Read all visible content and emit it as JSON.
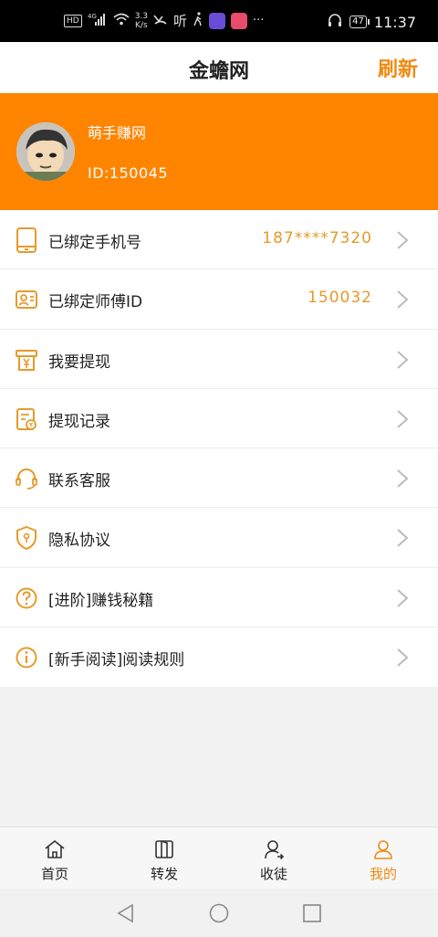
{
  "status_bar": {
    "hd": "HD",
    "network": "4G",
    "speed_top": "3.3",
    "speed_bottom": "K/s",
    "listen": "听",
    "dots": "···",
    "battery": "47",
    "time": "11:37"
  },
  "header": {
    "title": "金蟾网",
    "refresh_label": "刷新"
  },
  "profile": {
    "username": "萌手赚网",
    "user_id": "ID:150045"
  },
  "menu": {
    "items": [
      {
        "label": "已绑定手机号",
        "value": "187****7320",
        "icon": "phone-icon"
      },
      {
        "label": "已绑定师傅ID",
        "value": "150032",
        "icon": "id-card-icon"
      },
      {
        "label": "我要提现",
        "value": "",
        "icon": "withdraw-icon"
      },
      {
        "label": "提现记录",
        "value": "",
        "icon": "record-icon"
      },
      {
        "label": "联系客服",
        "value": "",
        "icon": "headset-icon"
      },
      {
        "label": "隐私协议",
        "value": "",
        "icon": "shield-icon"
      },
      {
        "label": "[进阶]赚钱秘籍",
        "value": "",
        "icon": "question-icon"
      },
      {
        "label": "[新手阅读]阅读规则",
        "value": "",
        "icon": "info-icon"
      }
    ]
  },
  "tabs": [
    {
      "label": "首页",
      "icon": "home-icon",
      "active": false
    },
    {
      "label": "转发",
      "icon": "book-icon",
      "active": false
    },
    {
      "label": "收徒",
      "icon": "add-user-icon",
      "active": false
    },
    {
      "label": "我的",
      "icon": "user-icon",
      "active": true
    }
  ],
  "colors": {
    "accent": "#ff8400",
    "value_text": "#e69a2a",
    "active_tab": "#f08a10"
  }
}
